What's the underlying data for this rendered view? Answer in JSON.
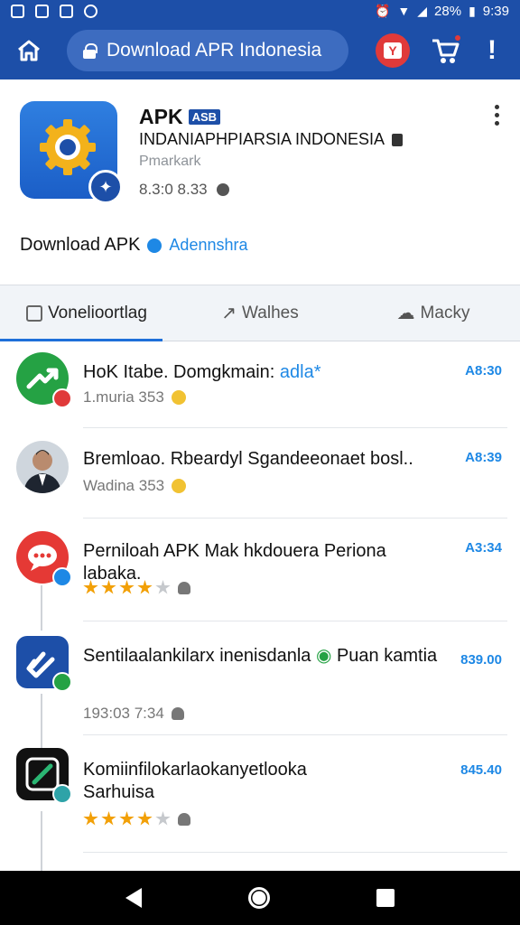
{
  "status_bar": {
    "battery": "28%",
    "time": "9:39"
  },
  "app_bar": {
    "url_text": "Download APR Indonesia",
    "more_label": "!"
  },
  "app_card": {
    "name": "APK",
    "name_tag": "ASB",
    "developer": "INDANIAPHPIARSIA INDONESIA",
    "subtitle": "Pmarkark",
    "meta": "8.3:0 8.33",
    "download_label": "Download APK",
    "download_author": "Adennshra"
  },
  "tabs": [
    {
      "label": "Vonelioortlag"
    },
    {
      "label": "Walhes"
    },
    {
      "label": "Macky"
    }
  ],
  "list": [
    {
      "title": "HoK Itabe. Domgkmain: ",
      "title_highlight": "adla*",
      "sub": "1.muria 353",
      "time": "A8:30",
      "avatar_color": "#25a244",
      "badge_color": "#e03a3a"
    },
    {
      "title": "Bremloao. Rbeardyl Sgandeeonaet bosl..",
      "sub": "Wadina 353",
      "time": "A8:39"
    },
    {
      "title": "Perniloah APK Mak hkdouera Periona labaka.",
      "rating": 4,
      "time": "A3:34",
      "avatar_color": "#e53935",
      "badge_color": "#1e88e5"
    },
    {
      "title": "Sentilaalankilarx inenisdanla",
      "title_tail": "Puan kamtia",
      "sub": "193:03 7:34",
      "time": "839.00",
      "avatar_color": "#1d4fa8",
      "badge_color": "#25a244"
    },
    {
      "title": "Komiinfilokarlaokanyetlooka Sarhuisa",
      "rating": 4,
      "time": "845.40",
      "avatar_color": "#111111",
      "badge_color": "#2ea3a8"
    }
  ],
  "colors": {
    "primary": "#1d4fa8",
    "accent": "#1e88e5",
    "star": "#f2a007"
  }
}
